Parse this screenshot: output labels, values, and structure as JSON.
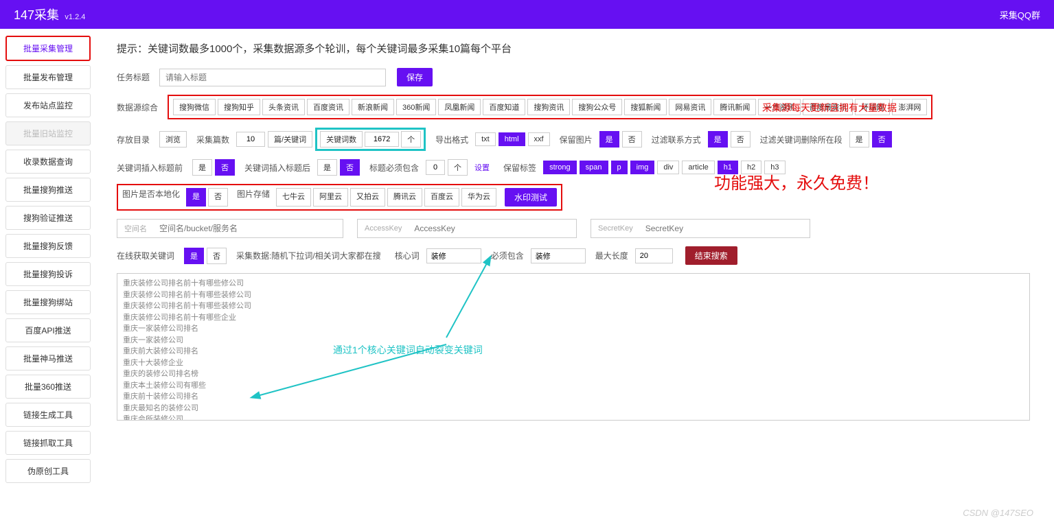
{
  "header": {
    "title": "147采集",
    "version": "v1.2.4",
    "qq_link": "采集QQ群"
  },
  "sidebar": {
    "items": [
      "批量采集管理",
      "批量发布管理",
      "发布站点监控",
      "批量旧站监控",
      "收录数据查询",
      "批量搜狗推送",
      "搜狗验证推送",
      "批量搜狗反馈",
      "批量搜狗投诉",
      "批量搜狗绑站",
      "百度API推送",
      "批量神马推送",
      "批量360推送",
      "链接生成工具",
      "链接抓取工具",
      "伪原创工具"
    ]
  },
  "main": {
    "tip": "提示：关键词数最多1000个，采集数据源多个轮训，每个关键词最多采集10篇每个平台",
    "task_title_label": "任务标题",
    "task_title_placeholder": "请输入标题",
    "save_btn": "保存",
    "source_label": "数据源综合",
    "sources": [
      "搜狗微信",
      "搜狗知乎",
      "头条资讯",
      "百度资讯",
      "新浪新闻",
      "360新闻",
      "凤凰新闻",
      "百度知道",
      "搜狗资讯",
      "搜狗公众号",
      "搜狐新闻",
      "网易资讯",
      "腾讯新闻",
      "一点资讯",
      "百度最资讯",
      "环球网",
      "澎湃网"
    ],
    "row3": {
      "storage_label": "存放目录",
      "browse": "浏览",
      "collect_num_label": "采集篇数",
      "collect_num": "10",
      "collect_unit": "篇/关键词",
      "keyword_num_label": "关键词数",
      "keyword_num": "1672",
      "keyword_unit": "个",
      "output_label": "导出格式",
      "formats": [
        "txt",
        "html",
        "xxf"
      ],
      "keep_img_label": "保留图片",
      "yes": "是",
      "no": "否",
      "filter_contact_label": "过滤联系方式",
      "filter_kw_label": "过滤关键词删除所在段"
    },
    "row4": {
      "insert_before_label": "关键词插入标题前",
      "yes": "是",
      "no": "否",
      "insert_after_label": "关键词插入标题后",
      "must_contain_label": "标题必须包含",
      "count": "0",
      "unit": "个",
      "setting": "设置",
      "keep_tags_label": "保留标签",
      "tags": [
        "strong",
        "span",
        "p",
        "img",
        "div",
        "article",
        "h1",
        "h2",
        "h3"
      ]
    },
    "row5": {
      "img_local_label": "图片是否本地化",
      "yes": "是",
      "no": "否",
      "img_store_label": "图片存储",
      "stores": [
        "七牛云",
        "阿里云",
        "又拍云",
        "腾讯云",
        "百度云",
        "华为云"
      ],
      "watermark_btn": "水印测试"
    },
    "row6": {
      "space_prefix": "空间名",
      "space_placeholder": "空间名/bucket/服务名",
      "ak_prefix": "AccessKey",
      "ak_placeholder": "AccessKey",
      "sk_prefix": "SecretKey",
      "sk_placeholder": "SecretKey"
    },
    "row7": {
      "online_kw_label": "在线获取关键词",
      "yes": "是",
      "no": "否",
      "collect_note": "采集数据:随机下拉词/相关词大家都在搜",
      "core_kw_label": "核心词",
      "core_kw": "装修",
      "must_contain_label": "必须包含",
      "must_contain": "装修",
      "max_len_label": "最大长度",
      "max_len": "20",
      "end_btn": "结束搜索"
    },
    "keywords": "重庆装修公司排名前十有哪些修公司\n重庆装修公司排名前十有哪些装修公司\n重庆装修公司排名前十有哪些装修公司\n重庆装修公司排名前十有哪些企业\n重庆一家装修公司排名\n重庆一家装修公司\n重庆前大装修公司排名\n重庆十大装修企业\n重庆的装修公司排名榜\n重庆本土装修公司有哪些\n重庆前十装修公司排名\n重庆最知名的装修公司\n重庆会所装修公司\n重庆三房的装修公司有哪些\n重庆装修公司那家优质力度大"
  },
  "annotations": {
    "source_note": "采集源每天更新且拥有大量数据",
    "feature_note": "功能强大，永久免费！",
    "keyword_note": "通过1个核心关键词自动裂变关键词"
  },
  "watermark": "CSDN @147SEO"
}
